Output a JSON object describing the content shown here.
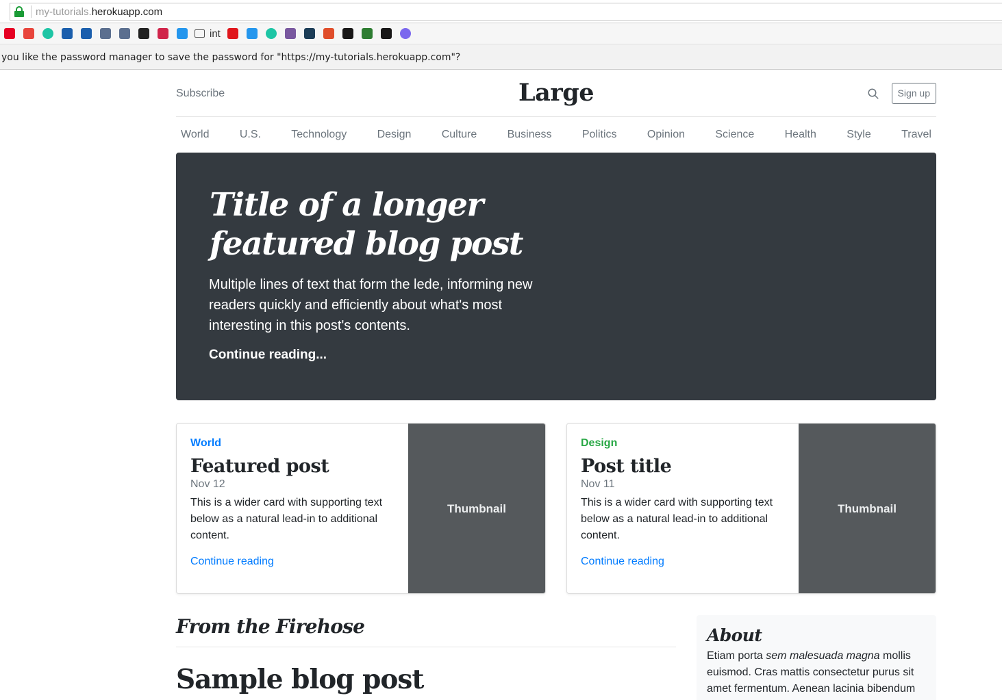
{
  "browser": {
    "url_subdomain": "my-tutorials.",
    "url_domain": "herokuapp.com",
    "bookmarks": [
      {
        "icon": "pinterest-icon",
        "color": "#e60023",
        "label": ""
      },
      {
        "icon": "video-icon",
        "color": "#e8453c",
        "label": ""
      },
      {
        "icon": "circle-app-icon",
        "color": "#1ec5a5",
        "label": ""
      },
      {
        "icon": "list-icon",
        "color": "#1b5fad",
        "label": ""
      },
      {
        "icon": "list-icon",
        "color": "#1b5fad",
        "label": ""
      },
      {
        "icon": "wordpress-icon",
        "color": "#5b6f8f",
        "label": ""
      },
      {
        "icon": "wordpress-icon",
        "color": "#5b6f8f",
        "label": ""
      },
      {
        "icon": "chart-app-icon",
        "color": "#222222",
        "label": ""
      },
      {
        "icon": "mouth-icon",
        "color": "#d0244a",
        "label": ""
      },
      {
        "icon": "docker-icon",
        "color": "#2496ed",
        "label": ""
      },
      {
        "icon": "folder-icon",
        "color": "#555555",
        "label": "int"
      },
      {
        "icon": "oracle-icon",
        "color": "#e0161c",
        "label": ""
      },
      {
        "icon": "docker-icon",
        "color": "#2496ed",
        "label": ""
      },
      {
        "icon": "circle-app-icon",
        "color": "#1ec5a5",
        "label": ""
      },
      {
        "icon": "heroku-icon",
        "color": "#79589f",
        "label": ""
      },
      {
        "icon": "cube-icon",
        "color": "#1c3d57",
        "label": ""
      },
      {
        "icon": "gear-app-icon",
        "color": "#e04e2b",
        "label": ""
      },
      {
        "icon": "github-icon",
        "color": "#181717",
        "label": ""
      },
      {
        "icon": "tree-icon",
        "color": "#2e7d32",
        "label": ""
      },
      {
        "icon": "github-icon",
        "color": "#181717",
        "label": ""
      },
      {
        "icon": "mattermost-icon",
        "color": "#7b68ee",
        "label": ""
      }
    ],
    "infobar_text": "you like the password manager to save the password for \"https://my-tutorials.herokuapp.com\"?"
  },
  "header": {
    "subscribe": "Subscribe",
    "logo": "Large",
    "signup": "Sign up"
  },
  "nav": [
    "World",
    "U.S.",
    "Technology",
    "Design",
    "Culture",
    "Business",
    "Politics",
    "Opinion",
    "Science",
    "Health",
    "Style",
    "Travel"
  ],
  "jumbotron": {
    "title": "Title of a longer featured blog post",
    "lede": "Multiple lines of text that form the lede, informing new readers quickly and efficiently about what's most interesting in this post's contents.",
    "link": "Continue reading..."
  },
  "cards": [
    {
      "category": "World",
      "category_color": "#007bff",
      "title": "Featured post",
      "date": "Nov 12",
      "text": "This is a wider card with supporting text below as a natural lead-in to additional content.",
      "link": "Continue reading",
      "thumb": "Thumbnail"
    },
    {
      "category": "Design",
      "category_color": "#28a745",
      "title": "Post title",
      "date": "Nov 11",
      "text": "This is a wider card with supporting text below as a natural lead-in to additional content.",
      "link": "Continue reading",
      "thumb": "Thumbnail"
    }
  ],
  "firehose": {
    "heading": "From the Firehose",
    "post_title": "Sample blog post"
  },
  "about": {
    "heading": "About",
    "text_before": "Etiam porta ",
    "text_em": "sem malesuada magna",
    "text_after": " mollis euismod. Cras mattis consectetur purus sit amet fermentum. Aenean lacinia bibendum"
  }
}
